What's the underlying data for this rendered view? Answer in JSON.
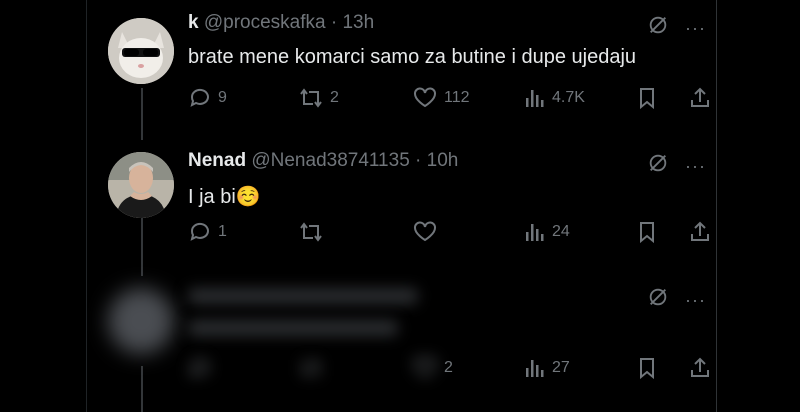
{
  "tweets": [
    {
      "name": "k",
      "handle": "@proceskafka",
      "separator": "·",
      "time": "13h",
      "text": "brate mene komarci samo za butine i dupe ujedaju",
      "stats": {
        "replies": "9",
        "retweets": "2",
        "likes": "112",
        "views": "4.7K"
      }
    },
    {
      "name": "Nenad",
      "handle": "@Nenad38741135",
      "separator": "·",
      "time": "10h",
      "text": "I ja bi☺️",
      "stats": {
        "replies": "1",
        "retweets": "",
        "likes": "",
        "views": "24"
      }
    },
    {
      "name": "",
      "handle": "",
      "separator": "",
      "time": "",
      "text": "",
      "stats": {
        "replies": "",
        "retweets": "",
        "likes": "2",
        "views": "27"
      }
    }
  ],
  "icons": {
    "reply": "reply-icon",
    "retweet": "retweet-icon",
    "like": "heart-icon",
    "views": "views-icon",
    "bookmark": "bookmark-icon",
    "share": "share-icon",
    "grok": "grok-icon",
    "more": "more-icon"
  },
  "colors": {
    "background": "#000000",
    "text": "#e7e9ea",
    "muted": "#71767b"
  }
}
